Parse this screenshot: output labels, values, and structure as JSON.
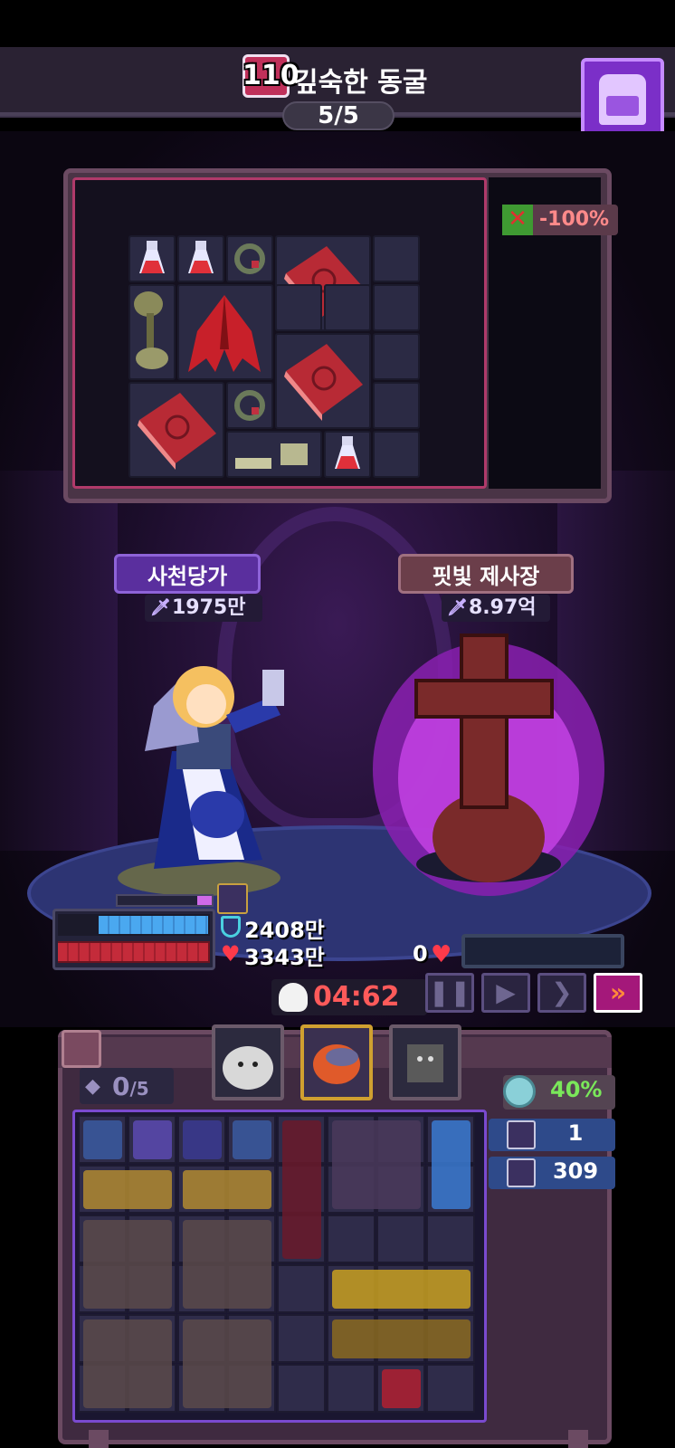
{
  "stage": {
    "level": "110",
    "name": "깊숙한 동굴",
    "wave": "5/5"
  },
  "header": {
    "bag_icon": "backpack-icon"
  },
  "loot": {
    "penalty": "-100%",
    "penalty_icon": "no-heal-icon",
    "items": [
      "potion",
      "potion",
      "ring",
      "spellbook",
      "herb",
      "demon-wings",
      "spellbook",
      "spellbook",
      "ring",
      "bones",
      "potion"
    ]
  },
  "player": {
    "name": "사천당가",
    "power": "1975만",
    "shield": "2408만",
    "hp": "3343만",
    "shield_fill": 0.73,
    "hp_fill": 1.0
  },
  "enemy": {
    "name": "핏빛 제사장",
    "power": "8.97억",
    "hp": "0",
    "hp_fill": 0.0
  },
  "battle": {
    "timer": "04:62",
    "controls": {
      "pause": "❚❚",
      "play": "▶",
      "fast": "❯",
      "fastest": "»"
    }
  },
  "inventory": {
    "slots_used": "0",
    "slots_total": "/5",
    "gem_percent": "40%",
    "buffs": [
      {
        "icon": "trinket-icon",
        "value": "1"
      },
      {
        "icon": "crossed-swords-icon",
        "value": "309"
      }
    ]
  },
  "colors": {
    "accent_purple": "#7b2fc8",
    "hp_red": "#c42b3a",
    "shield_blue": "#4aa8f0",
    "timer_red": "#ff5a5a",
    "gem_green": "#7ae85a"
  }
}
